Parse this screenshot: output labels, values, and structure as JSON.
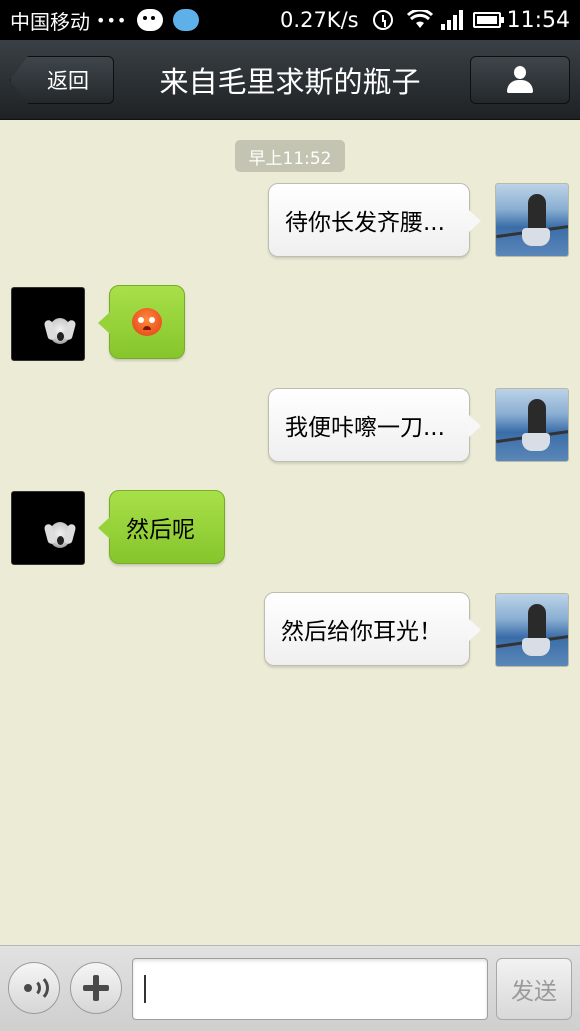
{
  "status_bar": {
    "carrier": "中国移动",
    "dots": "•••",
    "speed": "0.27K/s",
    "time": "11:54",
    "icons": [
      "wechat-icon",
      "qq-icon",
      "alarm-icon",
      "wifi-icon",
      "signal-icon",
      "battery-icon"
    ]
  },
  "header": {
    "back_label": "返回",
    "title": "来自毛里求斯的瓶子",
    "profile_icon": "person-icon"
  },
  "chat": {
    "timestamp": "早上11:52",
    "messages": [
      {
        "direction": "out",
        "text": "待你长发齐腰..."
      },
      {
        "direction": "in",
        "text": "",
        "emoji": "angry-face-emoji"
      },
      {
        "direction": "out",
        "text": "我便咔嚓一刀..."
      },
      {
        "direction": "in",
        "text": "然后呢"
      },
      {
        "direction": "out",
        "text": "然后给你耳光！"
      }
    ]
  },
  "input_bar": {
    "voice_icon": "voice-icon",
    "plus_icon": "plus-icon",
    "input_value": "",
    "send_label": "发送"
  },
  "colors": {
    "chat_background": "#ecebd6",
    "incoming_bubble": "#97d23a",
    "outgoing_bubble": "#ffffff",
    "header_background": "#2a2f33"
  }
}
